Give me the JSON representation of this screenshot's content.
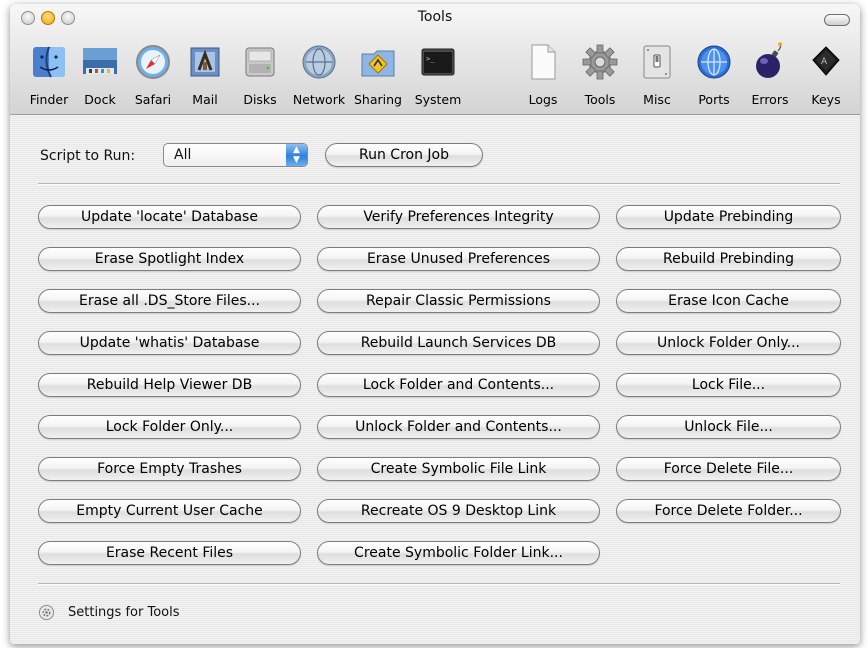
{
  "window": {
    "title": "Tools"
  },
  "toolbar": {
    "items": [
      {
        "label": "Finder",
        "icon": "finder-icon"
      },
      {
        "label": "Dock",
        "icon": "dock-icon"
      },
      {
        "label": "Safari",
        "icon": "safari-icon"
      },
      {
        "label": "Mail",
        "icon": "mail-icon"
      },
      {
        "label": "Disks",
        "icon": "disks-icon"
      },
      {
        "label": "Network",
        "icon": "network-icon"
      },
      {
        "label": "Sharing",
        "icon": "sharing-icon"
      },
      {
        "label": "System",
        "icon": "system-icon"
      },
      {
        "label": "Logs",
        "icon": "logs-icon"
      },
      {
        "label": "Tools",
        "icon": "tools-icon"
      },
      {
        "label": "Misc",
        "icon": "misc-icon"
      },
      {
        "label": "Ports",
        "icon": "ports-icon"
      },
      {
        "label": "Errors",
        "icon": "errors-icon"
      },
      {
        "label": "Keys",
        "icon": "keys-icon"
      }
    ]
  },
  "script": {
    "label": "Script to Run:",
    "selected": "All",
    "run_button": "Run Cron Job"
  },
  "buttons": {
    "col1": [
      "Update 'locate' Database",
      "Erase Spotlight Index",
      "Erase all .DS_Store Files...",
      "Update 'whatis' Database",
      "Rebuild Help Viewer DB",
      "Lock Folder Only...",
      "Force Empty Trashes",
      "Empty Current User Cache",
      "Erase Recent Files"
    ],
    "col2": [
      "Verify Preferences Integrity",
      "Erase Unused Preferences",
      "Repair Classic Permissions",
      "Rebuild Launch Services DB",
      "Lock Folder and Contents...",
      "Unlock Folder and Contents...",
      "Create Symbolic File Link",
      "Recreate OS 9 Desktop Link",
      "Create Symbolic Folder Link..."
    ],
    "col3": [
      "Update Prebinding",
      "Rebuild Prebinding",
      "Erase Icon Cache",
      "Unlock Folder Only...",
      "Lock File...",
      "Unlock File...",
      "Force Delete File...",
      "Force Delete Folder..."
    ]
  },
  "footer": {
    "label": "Settings for Tools",
    "icon": "settings-gear-icon"
  },
  "colors": {
    "accent": "#2f7fd9",
    "window_bg": "#ededed"
  }
}
